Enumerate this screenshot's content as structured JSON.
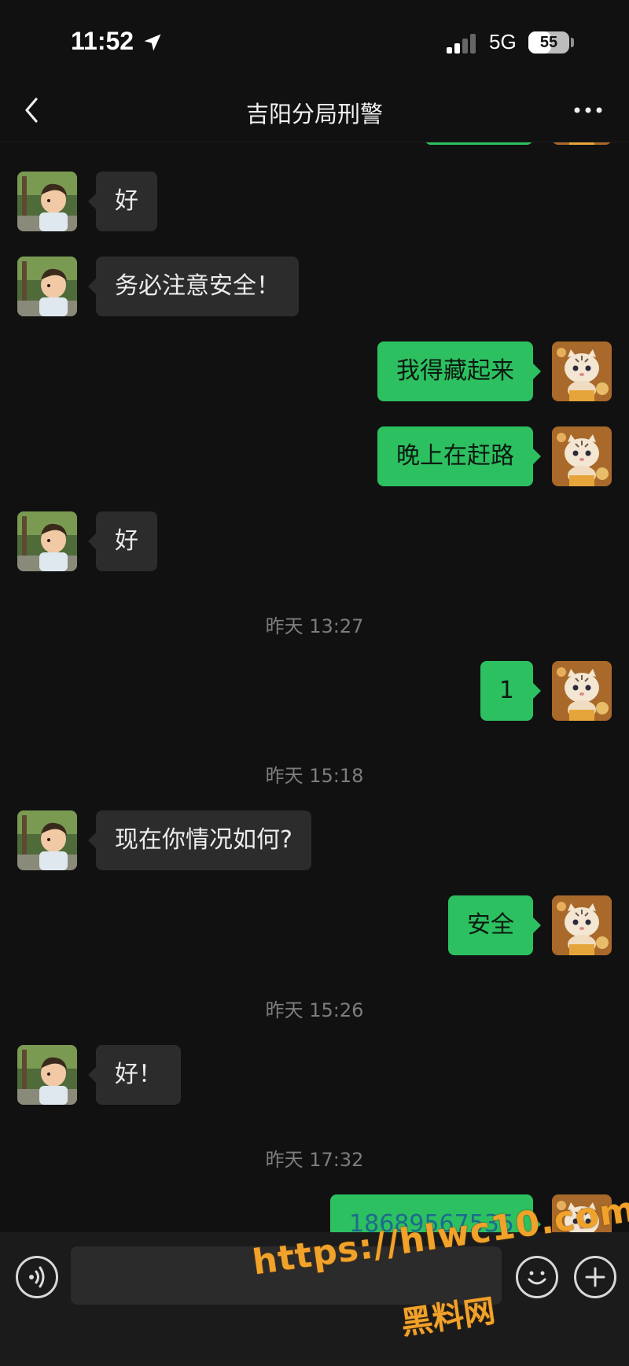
{
  "status_bar": {
    "time": "11:52",
    "network": "5G",
    "battery": "55",
    "battery_level": 0.55
  },
  "header": {
    "title": "吉阳分局刑警"
  },
  "messages": [
    {
      "side": "in",
      "text": "好"
    },
    {
      "side": "in",
      "text": "务必注意安全！"
    },
    {
      "side": "out",
      "text": "我得藏起来"
    },
    {
      "side": "out",
      "text": "晚上在赶路"
    },
    {
      "side": "in",
      "text": "好"
    },
    {
      "side": "out",
      "text": "1"
    },
    {
      "side": "in",
      "text": "现在你情况如何?"
    },
    {
      "side": "out",
      "text": "安全"
    },
    {
      "side": "in",
      "text": "好！"
    },
    {
      "side": "out",
      "text": "18689567535"
    }
  ],
  "timestamps": [
    "昨天 13:27",
    "昨天 15:18",
    "昨天 15:26",
    "昨天 17:32"
  ],
  "input": {
    "placeholder": ""
  },
  "watermark": {
    "url": "https://hlwc10.com",
    "name": "黑料网"
  },
  "colors": {
    "outgoing_bubble": "#2dc061",
    "incoming_bubble": "#2c2c2c",
    "background": "#111111",
    "phone_link": "#1d6b8c"
  },
  "icons": [
    "location-arrow-icon",
    "signal-icon",
    "battery-icon",
    "back-chevron-icon",
    "more-dots-icon",
    "voice-icon",
    "emoji-icon",
    "plus-icon"
  ]
}
